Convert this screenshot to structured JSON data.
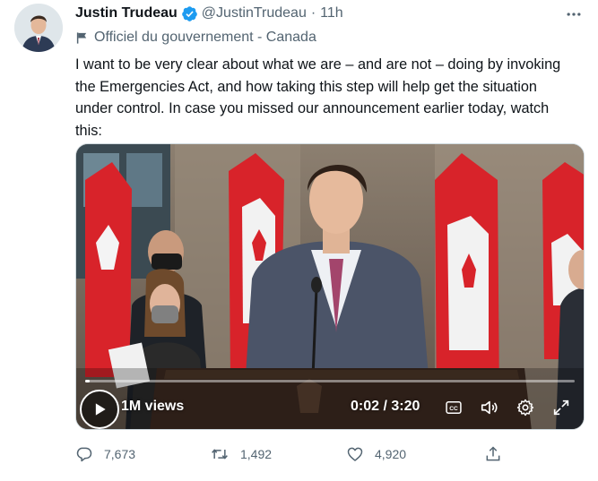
{
  "author": {
    "name": "Justin Trudeau",
    "handle": "@JustinTrudeau",
    "separator": "·",
    "time": "11h",
    "avatar_icon": "avatar-photo",
    "verified_icon": "verified-badge-icon",
    "verified_color": "#1d9bf0"
  },
  "account_label": {
    "icon": "flag-icon",
    "text": "Officiel du gouvernement - Canada"
  },
  "tweet": {
    "lines": [
      "I want to be very clear about what we are – and are not – doing by invoking",
      "the Emergencies Act, and how taking this step will help get the situation",
      "under control. In case you missed our announcement earlier today, watch",
      "this:"
    ]
  },
  "video": {
    "views": "1M views",
    "timecode": "0:02 / 3:20",
    "progress_fraction": 0.01,
    "controls": [
      "play-icon",
      "captions-icon",
      "volume-icon",
      "settings-icon",
      "fullscreen-icon"
    ]
  },
  "actions": {
    "replies": "7,673",
    "retweets": "1,492",
    "likes": "4,920",
    "icons": [
      "reply-icon",
      "retweet-icon",
      "like-icon",
      "share-icon"
    ]
  },
  "colors": {
    "text_primary": "#0f1419",
    "text_secondary": "#536471",
    "border": "#cfd9de"
  }
}
